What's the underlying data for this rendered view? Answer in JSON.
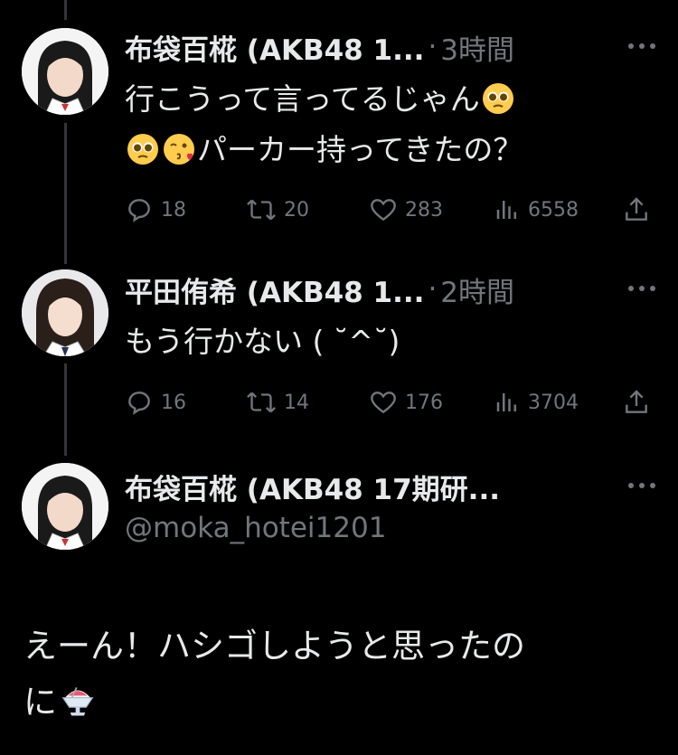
{
  "colors": {
    "background": "#000000",
    "text": "#e7e9ea",
    "secondary": "#71767b",
    "line": "#333639"
  },
  "tweets": [
    {
      "name": "布袋百椛 (AKB48 1...",
      "separator": "·",
      "time": "3時間",
      "lines": [
        "行こうって言ってるじゃん",
        "パーカー持ってきたの？"
      ],
      "emojis": [
        "pleading-face",
        "pleading-face",
        "face-blowing-kiss"
      ],
      "stats": {
        "replies": "18",
        "retweets": "20",
        "likes": "283",
        "views": "6558"
      }
    },
    {
      "name": "平田侑希 (AKB48 1...",
      "separator": "·",
      "time": "2時間",
      "lines": [
        "もう行かない ( ˘^˘)"
      ],
      "stats": {
        "replies": "16",
        "retweets": "14",
        "likes": "176",
        "views": "3704"
      }
    }
  ],
  "main_tweet": {
    "name": "布袋百椛 (AKB48 17期研...",
    "handle": "@moka_hotei1201",
    "line1": "えーん！ハシゴしようと思ったの",
    "line2": "に",
    "emoji": "shaved-ice"
  }
}
